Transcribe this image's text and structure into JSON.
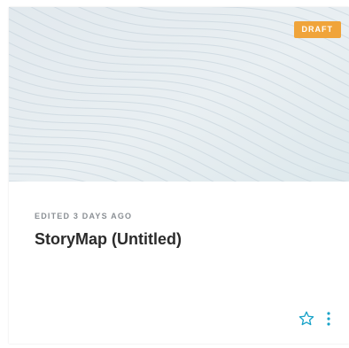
{
  "card": {
    "badge": "DRAFT",
    "meta": "EDITED 3 DAYS AGO",
    "title": "StoryMap (Untitled)",
    "icons": {
      "favorite": "star-outline-icon",
      "more": "more-vertical-icon"
    }
  },
  "colors": {
    "badge_bg": "#f0a43a",
    "accent": "#17a2c8",
    "thumbnail_bg": "#e7eef2",
    "wave_line": "#c9d6dd"
  }
}
